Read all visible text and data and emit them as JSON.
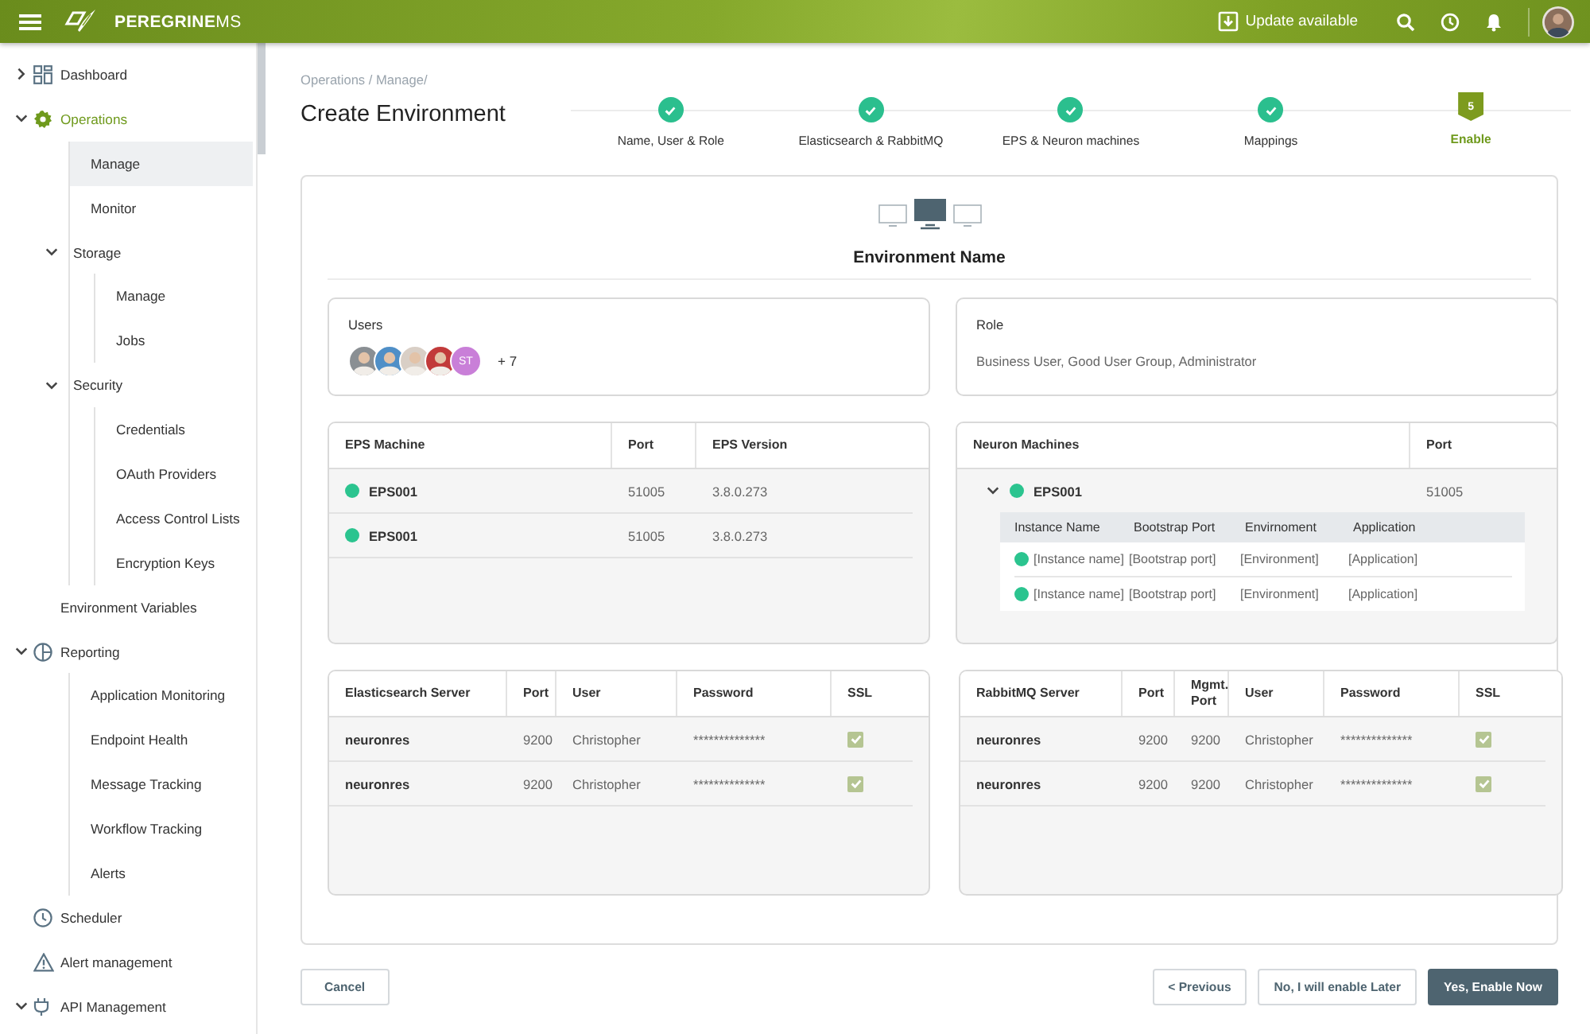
{
  "header": {
    "logo": "**PEREGRINE**MS",
    "update": "Update available"
  },
  "sidebar": {
    "items": [
      {
        "label": "Dashboard",
        "active": false,
        "expanded": false
      },
      {
        "label": "Operations",
        "active": true,
        "expanded": true,
        "children": [
          {
            "label": "Manage",
            "selected": true
          },
          {
            "label": "Monitor",
            "selected": false
          },
          {
            "label": "Storage",
            "selected": false,
            "expanded": true,
            "children": [
              {
                "label": "Manage",
                "selected": false
              },
              {
                "label": "Jobs",
                "selected": false
              }
            ]
          },
          {
            "label": "Security",
            "selected": false,
            "expanded": true,
            "children": [
              {
                "label": "Credentials",
                "selected": false
              },
              {
                "label": "OAuth Providers",
                "selected": false
              },
              {
                "label": "Access Control Lists",
                "selected": false
              },
              {
                "label": "Encryption Keys",
                "selected": false
              }
            ]
          }
        ]
      },
      {
        "label": "Environment Variables",
        "active": false
      },
      {
        "label": "Reporting",
        "active": false,
        "expanded": true,
        "children": [
          {
            "label": "Application Monitoring",
            "selected": false
          },
          {
            "label": "Endpoint Health",
            "selected": false
          },
          {
            "label": "Message Tracking",
            "selected": false
          },
          {
            "label": "Workflow Tracking",
            "selected": false
          },
          {
            "label": "Alerts",
            "selected": false
          }
        ]
      },
      {
        "label": "Scheduler",
        "active": false
      },
      {
        "label": "Alert management",
        "active": false
      },
      {
        "label": "API Management",
        "active": false,
        "expanded": true
      }
    ]
  },
  "breadcrumb": "Operations / Manage/",
  "title": "Create Environment",
  "steps": [
    {
      "label": "Name, User & Role",
      "done": true
    },
    {
      "label": "Elasticsearch & RabbitMQ",
      "done": true
    },
    {
      "label": "EPS & Neuron machines",
      "done": true
    },
    {
      "label": "Mappings",
      "done": true
    },
    {
      "label": "Enable",
      "done": false,
      "number": "5"
    }
  ],
  "environment_name": "Environment Name",
  "users": {
    "label": "Users",
    "avatars": [
      {
        "kind": "photo"
      },
      {
        "kind": "photo"
      },
      {
        "kind": "photo"
      },
      {
        "kind": "photo"
      },
      {
        "kind": "initials",
        "initials": "ST",
        "color": "#c97fd8"
      }
    ],
    "more": "+ 7"
  },
  "role": {
    "label": "Role",
    "value": "Business User, Good User Group, Administrator"
  },
  "eps_table": {
    "columns": [
      "EPS Machine",
      "Port",
      "EPS Version"
    ],
    "rows": [
      {
        "online": true,
        "cells": [
          "EPS001",
          "51005",
          "3.8.0.273"
        ]
      },
      {
        "online": true,
        "cells": [
          "EPS001",
          "51005",
          "3.8.0.273"
        ]
      }
    ]
  },
  "neuron_table": {
    "columns": [
      "Neuron Machines",
      "Port"
    ],
    "machines": [
      {
        "expanded": true,
        "online": true,
        "name": "EPS001",
        "port": "51005",
        "instance_columns": [
          "Instance Name",
          "Bootstrap Port",
          "Envirnoment",
          "Application"
        ],
        "instances": [
          {
            "online": true,
            "cells": [
              "[Instance name]",
              "[Bootstrap port]",
              "[Environment]",
              "[Application]"
            ]
          },
          {
            "online": true,
            "cells": [
              "[Instance name]",
              "[Bootstrap port]",
              "[Environment]",
              "[Application]"
            ]
          }
        ]
      }
    ]
  },
  "elasticsearch_table": {
    "columns": [
      "Elasticsearch Server",
      "Port",
      "User",
      "Password",
      "SSL"
    ],
    "rows": [
      {
        "ssl": true,
        "cells": [
          "neuronres",
          "9200",
          "Christopher",
          "**************"
        ]
      },
      {
        "ssl": true,
        "cells": [
          "neuronres",
          "9200",
          "Christopher",
          "**************"
        ]
      }
    ]
  },
  "rabbitmq_table": {
    "columns": [
      "RabbitMQ Server",
      "Port",
      "Mgmt. Port",
      "User",
      "Password",
      "SSL"
    ],
    "rows": [
      {
        "ssl": true,
        "cells": [
          "neuronres",
          "9200",
          "9200",
          "Christopher",
          "**************"
        ]
      },
      {
        "ssl": true,
        "cells": [
          "neuronres",
          "9200",
          "9200",
          "Christopher",
          "**************"
        ]
      }
    ]
  },
  "buttons": [
    {
      "label": "Cancel",
      "kind": "outline"
    },
    {
      "label": "< Previous",
      "kind": "outline"
    },
    {
      "label": "No, I will enable Later",
      "kind": "outline"
    },
    {
      "label": "Yes, Enable Now",
      "kind": "primary"
    }
  ]
}
